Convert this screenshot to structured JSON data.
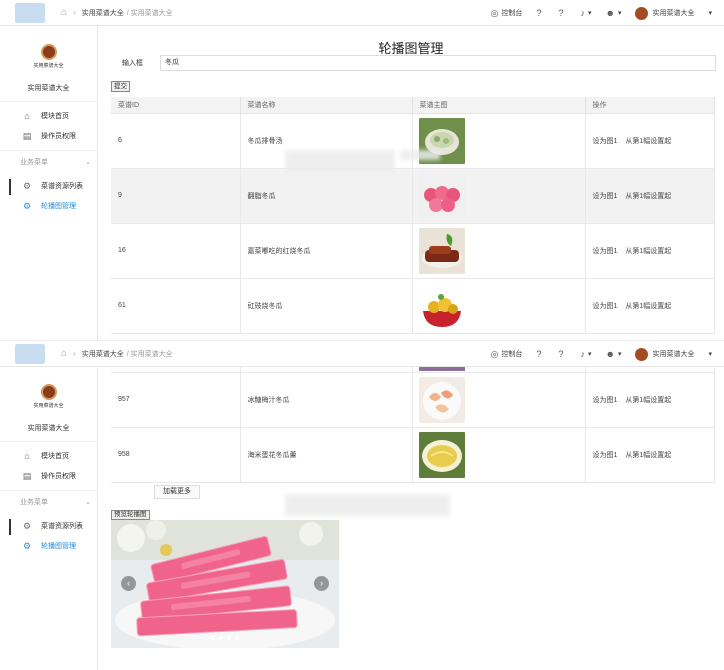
{
  "header": {
    "breadcrumb_root": "实用菜谱大全",
    "breadcrumb_sub": "/ 实用菜谱大全",
    "console_label": "控制台",
    "user_label": "实用菜谱大全",
    "icons": [
      "home-icon",
      "dashboard-icon",
      "help-icon",
      "help-icon",
      "bell-icon",
      "user-icon"
    ]
  },
  "sidebar": {
    "brand_tag": "实用菜谱大全",
    "brand_name": "实用菜谱大全",
    "items": [
      {
        "label": "模块首页",
        "icon": "home-icon"
      },
      {
        "label": "操作员权限",
        "icon": "document-icon"
      }
    ],
    "group_label": "业务菜单",
    "sub_items": [
      {
        "label": "菜谱资源列表",
        "icon": "gear-icon"
      },
      {
        "label": "轮播图管理",
        "icon": "gear-icon",
        "active": true
      }
    ]
  },
  "main": {
    "title": "轮播图管理",
    "input_label": "输入框",
    "input_value": "冬瓜",
    "submit_label": "提交",
    "columns": [
      "菜谱ID",
      "菜谱名称",
      "菜谱主图",
      "操作"
    ],
    "rows_top": [
      {
        "id": "6",
        "name": "冬瓜排骨汤",
        "shade": false
      },
      {
        "id": "9",
        "name": "翻脂冬瓜",
        "shade": true
      },
      {
        "id": "16",
        "name": "嘉菜嘟吃的红烧冬瓜",
        "shade": false
      },
      {
        "id": "61",
        "name": "豇豉烧冬瓜",
        "shade": false
      }
    ],
    "rows_bottom": [
      {
        "id": "957",
        "name": "冰糖梅汁冬瓜",
        "shade": false
      },
      {
        "id": "958",
        "name": "海米蛋花冬瓜羹",
        "shade": false
      }
    ],
    "op_set_first": "设为图1",
    "op_set_from": "从第1幅设置起",
    "load_more_label": "加载更多",
    "preview_label": "预览轮播图"
  },
  "colors": {
    "accent": "#1e8ae3",
    "carousel_pink": "#f0648c"
  }
}
